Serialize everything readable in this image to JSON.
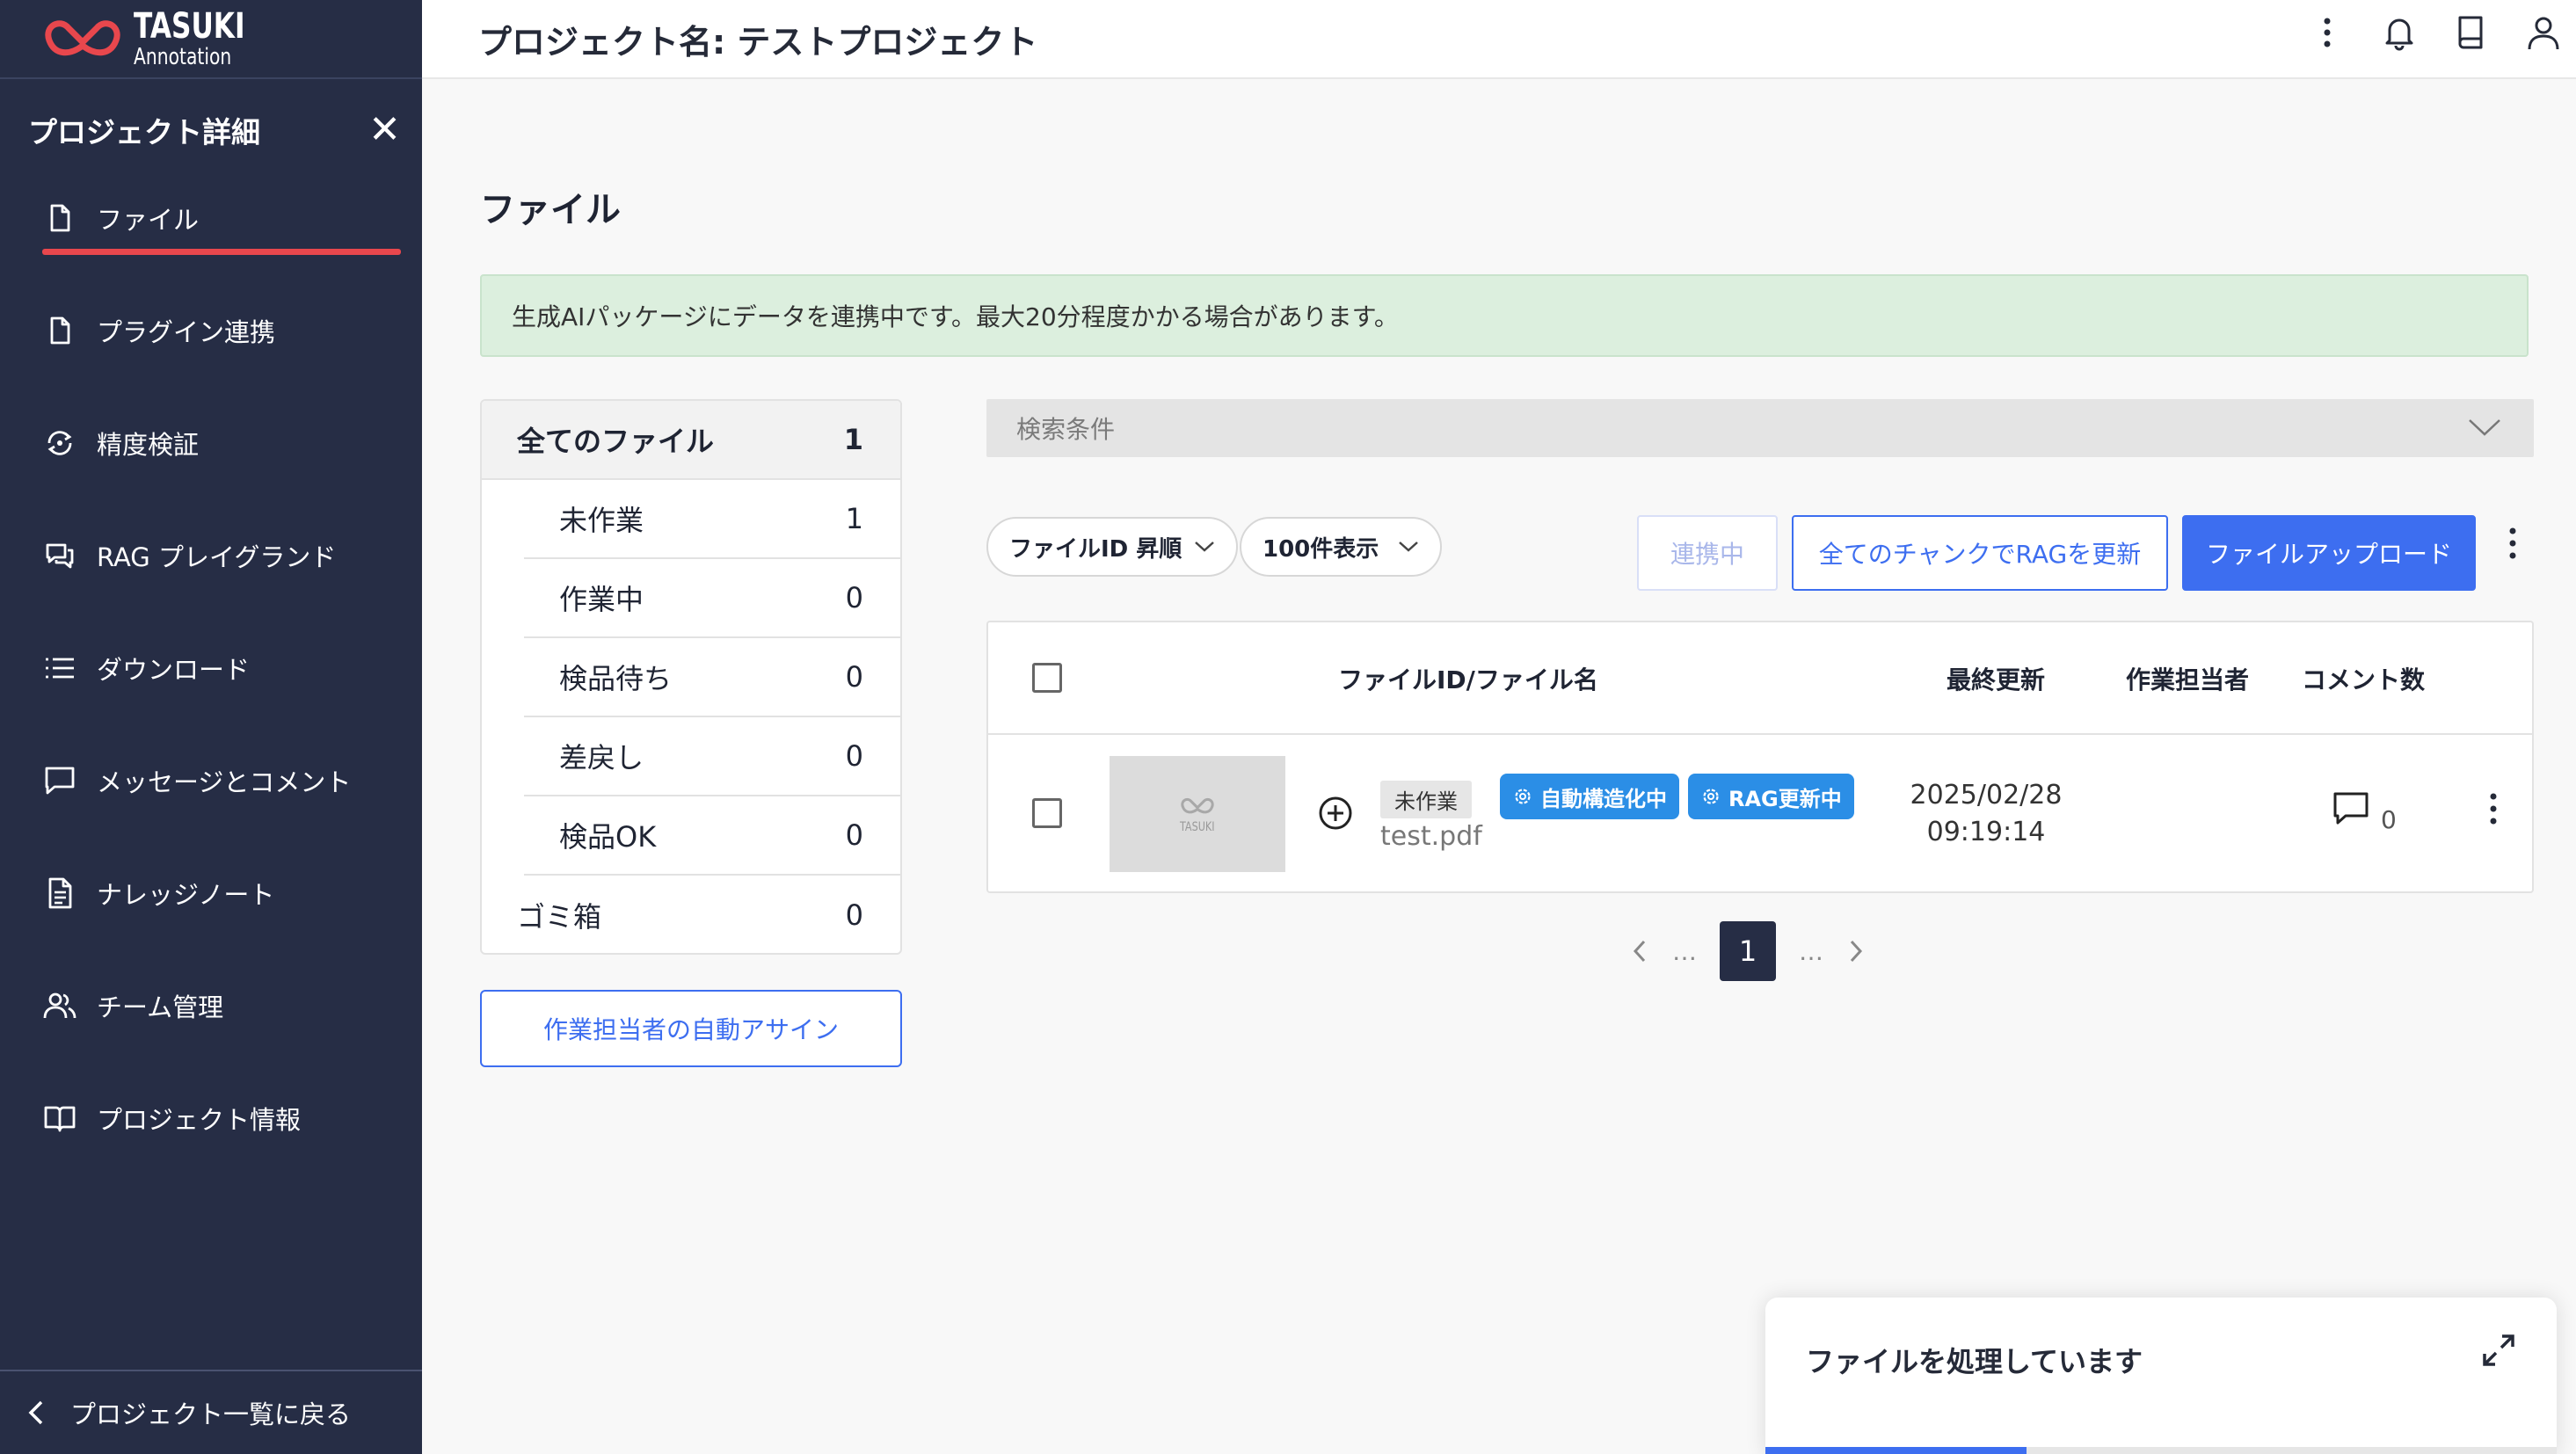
{
  "brand": {
    "name": "TASUKI",
    "sub": "Annotation",
    "accent": "#e8474d"
  },
  "sidebar": {
    "title": "プロジェクト詳細",
    "items": [
      {
        "label": "ファイル",
        "icon": "file-icon",
        "active": true
      },
      {
        "label": "プラグイン連携",
        "icon": "file-icon"
      },
      {
        "label": "精度検証",
        "icon": "accuracy-check-icon"
      },
      {
        "label": "RAG プレイグランド",
        "icon": "chat-icon"
      },
      {
        "label": "ダウンロード",
        "icon": "list-icon"
      },
      {
        "label": "メッセージとコメント",
        "icon": "message-icon"
      },
      {
        "label": "ナレッジノート",
        "icon": "note-icon"
      },
      {
        "label": "チーム管理",
        "icon": "team-icon"
      },
      {
        "label": "プロジェクト情報",
        "icon": "book-icon"
      }
    ],
    "back_label": "プロジェクト一覧に戻る"
  },
  "header": {
    "title": "プロジェクト名: テストプロジェクト"
  },
  "main": {
    "section_title": "ファイル",
    "alert": "生成AIパッケージにデータを連携中です。最大20分程度かかる場合があります。",
    "status": {
      "all": {
        "label": "全てのファイル",
        "count": "1"
      },
      "items": [
        {
          "label": "未作業",
          "count": "1"
        },
        {
          "label": "作業中",
          "count": "0"
        },
        {
          "label": "検品待ち",
          "count": "0"
        },
        {
          "label": "差戻し",
          "count": "0"
        },
        {
          "label": "検品OK",
          "count": "0"
        }
      ],
      "trash": {
        "label": "ゴミ箱",
        "count": "0"
      }
    },
    "assign_button": "作業担当者の自動アサイン",
    "search_label": "検索条件",
    "sort_select": "ファイルID 昇順",
    "page_size_select": "100件表示",
    "buttons": {
      "linking": "連携中",
      "rag_update": "全てのチャンクでRAGを更新",
      "upload": "ファイルアップロード"
    },
    "table": {
      "headers": {
        "file": "ファイルID/ファイル名",
        "updated": "最終更新",
        "assignee": "作業担当者",
        "comments": "コメント数"
      },
      "rows": [
        {
          "status": "未作業",
          "tag1": "自動構造化中",
          "tag2": "RAG更新中",
          "filename": "test.pdf",
          "date": "2025/02/28",
          "time": "09:19:14",
          "comments": "0",
          "thumb_label": "TASUKI"
        }
      ]
    },
    "pagination": {
      "current": "1",
      "ellipsis": "…"
    }
  },
  "toast": {
    "title": "ファイルを処理しています",
    "progress": 0.33
  }
}
